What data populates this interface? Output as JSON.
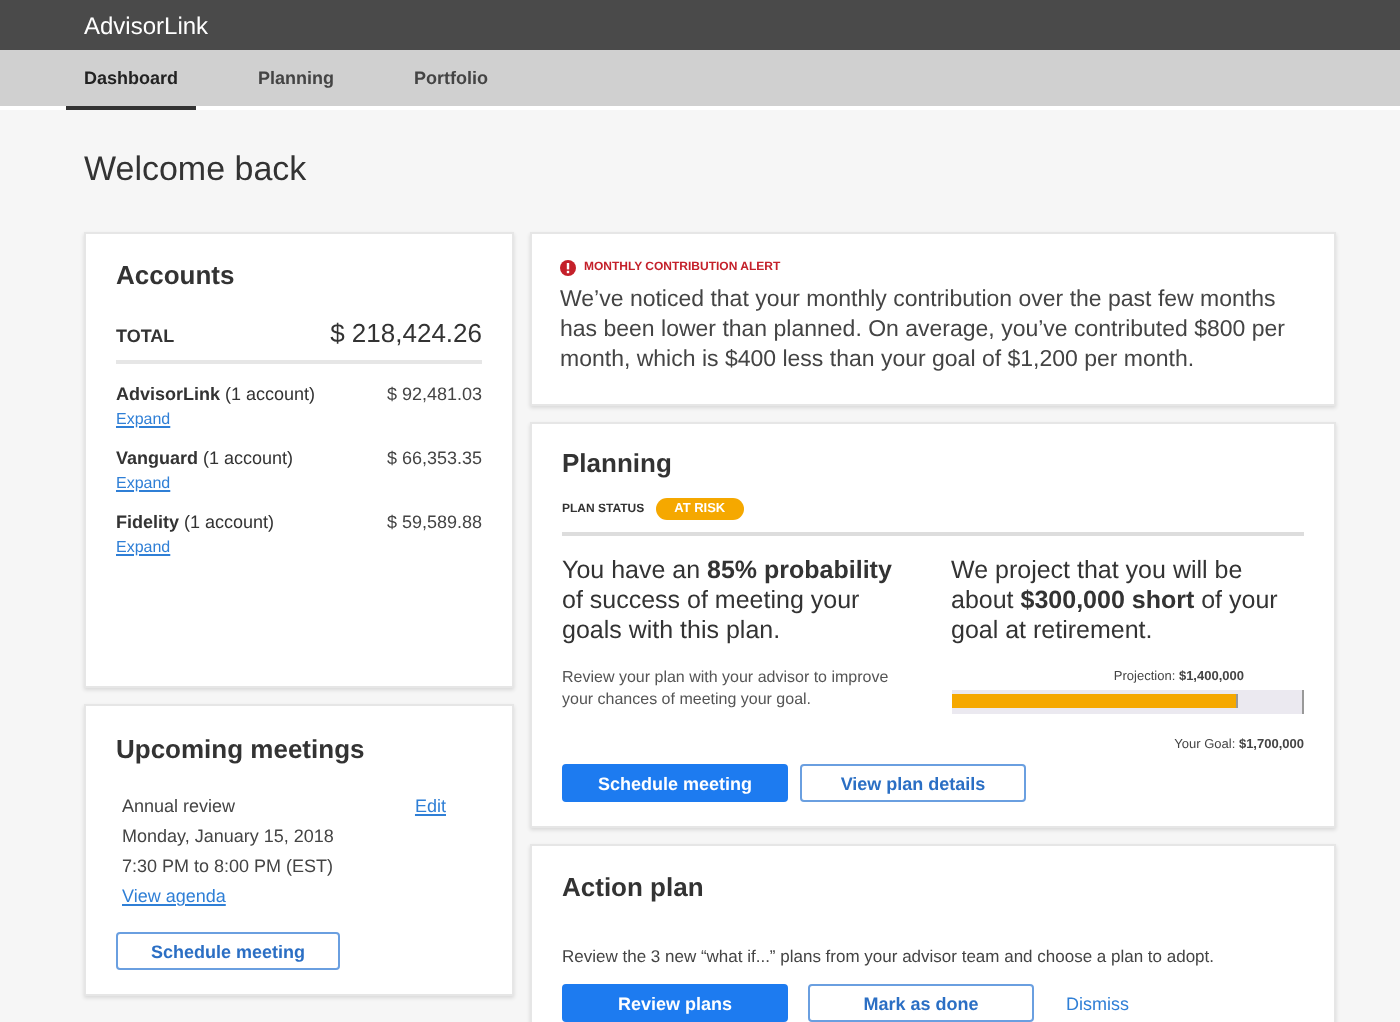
{
  "app": {
    "title": "AdvisorLink"
  },
  "tabs": [
    {
      "label": "Dashboard",
      "selected": true
    },
    {
      "label": "Planning",
      "selected": false
    },
    {
      "label": "Portfolio",
      "selected": false
    }
  ],
  "page_title": "Welcome back",
  "accounts": {
    "title": "Accounts",
    "total_label": "TOTAL",
    "total": "$ 218,424.26",
    "items": [
      {
        "name": "AdvisorLink",
        "count": "(1 account)",
        "amount": "$ 92,481.03",
        "link": "Expand"
      },
      {
        "name": "Vanguard",
        "count": "(1 account)",
        "amount": "$ 66,353.35",
        "link": "Expand"
      },
      {
        "name": "Fidelity",
        "count": "(1 account)",
        "amount": "$ 59,589.88",
        "link": "Expand"
      }
    ]
  },
  "meetings": {
    "title": "Upcoming meetings",
    "items": [
      {
        "name": "Annual review",
        "date": "Monday, January 15, 2018",
        "time": "7:30 PM to 8:00 PM (EST)",
        "edit": "Edit",
        "agenda": "View agenda"
      }
    ],
    "button": "Schedule meeting"
  },
  "alert": {
    "title": "MONTHLY CONTRIBUTION ALERT",
    "message": "We’ve noticed that your monthly contribution over the past few months has been lower than planned. On average, you’ve contributed $800 per month, which is $400 less than your goal of $1,200 per month."
  },
  "planning": {
    "title": "Planning",
    "status_label": "PLAN STATUS",
    "status": "AT RISK",
    "probability": "You have an **85% probability** of success of meeting your goals with this plan.",
    "advice": "Review your plan with your advisor to improve your chances of meeting your goal.",
    "projection_text": "We project that you will be about **$300,000 short** of your goal at retirement.",
    "projection": "Projection: **$1,400,000**",
    "goal": "Your Goal: **$1,700,000**",
    "level": 0.82,
    "buttons": [
      {
        "label": "Schedule meeting",
        "kind": "primary"
      },
      {
        "label": "View plan details",
        "kind": "secondary"
      }
    ]
  },
  "action_plan": {
    "title": "Action plan",
    "text": "Review the 3 new “what if...” plans from your advisor team and choose a plan to adopt.",
    "buttons": [
      {
        "label": "Review plans",
        "kind": "primary"
      },
      {
        "label": "Mark as done",
        "kind": "secondary"
      },
      {
        "label": "Dismiss",
        "kind": "link"
      }
    ]
  }
}
